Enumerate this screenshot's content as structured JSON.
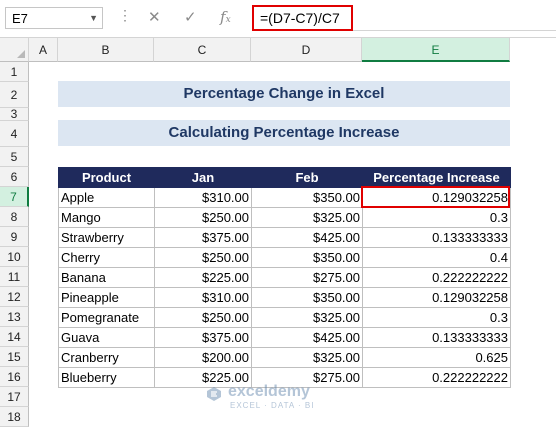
{
  "name_box": "E7",
  "formula": "=(D7-C7)/C7",
  "fx_icons": [
    "cancel-icon",
    "enter-icon",
    "function-icon"
  ],
  "columns": [
    "A",
    "B",
    "C",
    "D",
    "E"
  ],
  "rows": [
    "1",
    "2",
    "3",
    "4",
    "5",
    "6",
    "7",
    "8",
    "9",
    "10",
    "11",
    "12",
    "13",
    "14",
    "15",
    "16",
    "17",
    "18"
  ],
  "title": "Percentage Change in Excel",
  "subtitle": "Calculating Percentage Increase",
  "table": {
    "headers": [
      "Product",
      "Jan",
      "Feb",
      "Percentage Increase"
    ],
    "rows": [
      [
        "Apple",
        "$310.00",
        "$350.00",
        "0.129032258"
      ],
      [
        "Mango",
        "$250.00",
        "$325.00",
        "0.3"
      ],
      [
        "Strawberry",
        "$375.00",
        "$425.00",
        "0.133333333"
      ],
      [
        "Cherry",
        "$250.00",
        "$350.00",
        "0.4"
      ],
      [
        "Banana",
        "$225.00",
        "$275.00",
        "0.222222222"
      ],
      [
        "Pineapple",
        "$310.00",
        "$350.00",
        "0.129032258"
      ],
      [
        "Pomegranate",
        "$250.00",
        "$325.00",
        "0.3"
      ],
      [
        "Guava",
        "$375.00",
        "$425.00",
        "0.133333333"
      ],
      [
        "Cranberry",
        "$200.00",
        "$325.00",
        "0.625"
      ],
      [
        "Blueberry",
        "$225.00",
        "$275.00",
        "0.222222222"
      ]
    ]
  },
  "watermark": {
    "name": "exceldemy",
    "tag": "EXCEL · DATA · BI"
  },
  "colors": {
    "header_bg": "#1f2a5c",
    "band_bg": "#dce6f2",
    "highlight": "#e00000",
    "selection": "#107c41"
  }
}
